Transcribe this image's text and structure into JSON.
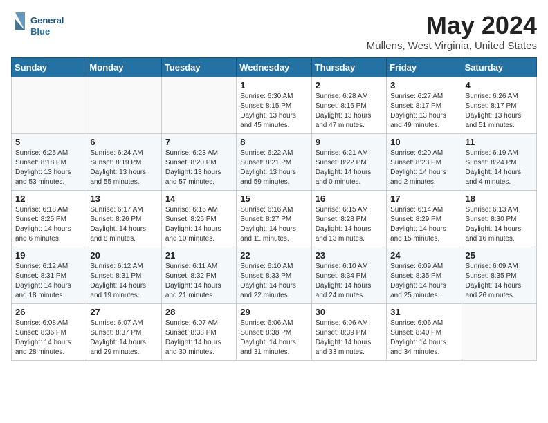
{
  "header": {
    "logo_general": "General",
    "logo_blue": "Blue",
    "month_year": "May 2024",
    "location": "Mullens, West Virginia, United States"
  },
  "days_of_week": [
    "Sunday",
    "Monday",
    "Tuesday",
    "Wednesday",
    "Thursday",
    "Friday",
    "Saturday"
  ],
  "weeks": [
    [
      {
        "day": "",
        "info": ""
      },
      {
        "day": "",
        "info": ""
      },
      {
        "day": "",
        "info": ""
      },
      {
        "day": "1",
        "info": "Sunrise: 6:30 AM\nSunset: 8:15 PM\nDaylight: 13 hours\nand 45 minutes."
      },
      {
        "day": "2",
        "info": "Sunrise: 6:28 AM\nSunset: 8:16 PM\nDaylight: 13 hours\nand 47 minutes."
      },
      {
        "day": "3",
        "info": "Sunrise: 6:27 AM\nSunset: 8:17 PM\nDaylight: 13 hours\nand 49 minutes."
      },
      {
        "day": "4",
        "info": "Sunrise: 6:26 AM\nSunset: 8:17 PM\nDaylight: 13 hours\nand 51 minutes."
      }
    ],
    [
      {
        "day": "5",
        "info": "Sunrise: 6:25 AM\nSunset: 8:18 PM\nDaylight: 13 hours\nand 53 minutes."
      },
      {
        "day": "6",
        "info": "Sunrise: 6:24 AM\nSunset: 8:19 PM\nDaylight: 13 hours\nand 55 minutes."
      },
      {
        "day": "7",
        "info": "Sunrise: 6:23 AM\nSunset: 8:20 PM\nDaylight: 13 hours\nand 57 minutes."
      },
      {
        "day": "8",
        "info": "Sunrise: 6:22 AM\nSunset: 8:21 PM\nDaylight: 13 hours\nand 59 minutes."
      },
      {
        "day": "9",
        "info": "Sunrise: 6:21 AM\nSunset: 8:22 PM\nDaylight: 14 hours\nand 0 minutes."
      },
      {
        "day": "10",
        "info": "Sunrise: 6:20 AM\nSunset: 8:23 PM\nDaylight: 14 hours\nand 2 minutes."
      },
      {
        "day": "11",
        "info": "Sunrise: 6:19 AM\nSunset: 8:24 PM\nDaylight: 14 hours\nand 4 minutes."
      }
    ],
    [
      {
        "day": "12",
        "info": "Sunrise: 6:18 AM\nSunset: 8:25 PM\nDaylight: 14 hours\nand 6 minutes."
      },
      {
        "day": "13",
        "info": "Sunrise: 6:17 AM\nSunset: 8:26 PM\nDaylight: 14 hours\nand 8 minutes."
      },
      {
        "day": "14",
        "info": "Sunrise: 6:16 AM\nSunset: 8:26 PM\nDaylight: 14 hours\nand 10 minutes."
      },
      {
        "day": "15",
        "info": "Sunrise: 6:16 AM\nSunset: 8:27 PM\nDaylight: 14 hours\nand 11 minutes."
      },
      {
        "day": "16",
        "info": "Sunrise: 6:15 AM\nSunset: 8:28 PM\nDaylight: 14 hours\nand 13 minutes."
      },
      {
        "day": "17",
        "info": "Sunrise: 6:14 AM\nSunset: 8:29 PM\nDaylight: 14 hours\nand 15 minutes."
      },
      {
        "day": "18",
        "info": "Sunrise: 6:13 AM\nSunset: 8:30 PM\nDaylight: 14 hours\nand 16 minutes."
      }
    ],
    [
      {
        "day": "19",
        "info": "Sunrise: 6:12 AM\nSunset: 8:31 PM\nDaylight: 14 hours\nand 18 minutes."
      },
      {
        "day": "20",
        "info": "Sunrise: 6:12 AM\nSunset: 8:31 PM\nDaylight: 14 hours\nand 19 minutes."
      },
      {
        "day": "21",
        "info": "Sunrise: 6:11 AM\nSunset: 8:32 PM\nDaylight: 14 hours\nand 21 minutes."
      },
      {
        "day": "22",
        "info": "Sunrise: 6:10 AM\nSunset: 8:33 PM\nDaylight: 14 hours\nand 22 minutes."
      },
      {
        "day": "23",
        "info": "Sunrise: 6:10 AM\nSunset: 8:34 PM\nDaylight: 14 hours\nand 24 minutes."
      },
      {
        "day": "24",
        "info": "Sunrise: 6:09 AM\nSunset: 8:35 PM\nDaylight: 14 hours\nand 25 minutes."
      },
      {
        "day": "25",
        "info": "Sunrise: 6:09 AM\nSunset: 8:35 PM\nDaylight: 14 hours\nand 26 minutes."
      }
    ],
    [
      {
        "day": "26",
        "info": "Sunrise: 6:08 AM\nSunset: 8:36 PM\nDaylight: 14 hours\nand 28 minutes."
      },
      {
        "day": "27",
        "info": "Sunrise: 6:07 AM\nSunset: 8:37 PM\nDaylight: 14 hours\nand 29 minutes."
      },
      {
        "day": "28",
        "info": "Sunrise: 6:07 AM\nSunset: 8:38 PM\nDaylight: 14 hours\nand 30 minutes."
      },
      {
        "day": "29",
        "info": "Sunrise: 6:06 AM\nSunset: 8:38 PM\nDaylight: 14 hours\nand 31 minutes."
      },
      {
        "day": "30",
        "info": "Sunrise: 6:06 AM\nSunset: 8:39 PM\nDaylight: 14 hours\nand 33 minutes."
      },
      {
        "day": "31",
        "info": "Sunrise: 6:06 AM\nSunset: 8:40 PM\nDaylight: 14 hours\nand 34 minutes."
      },
      {
        "day": "",
        "info": ""
      }
    ]
  ]
}
